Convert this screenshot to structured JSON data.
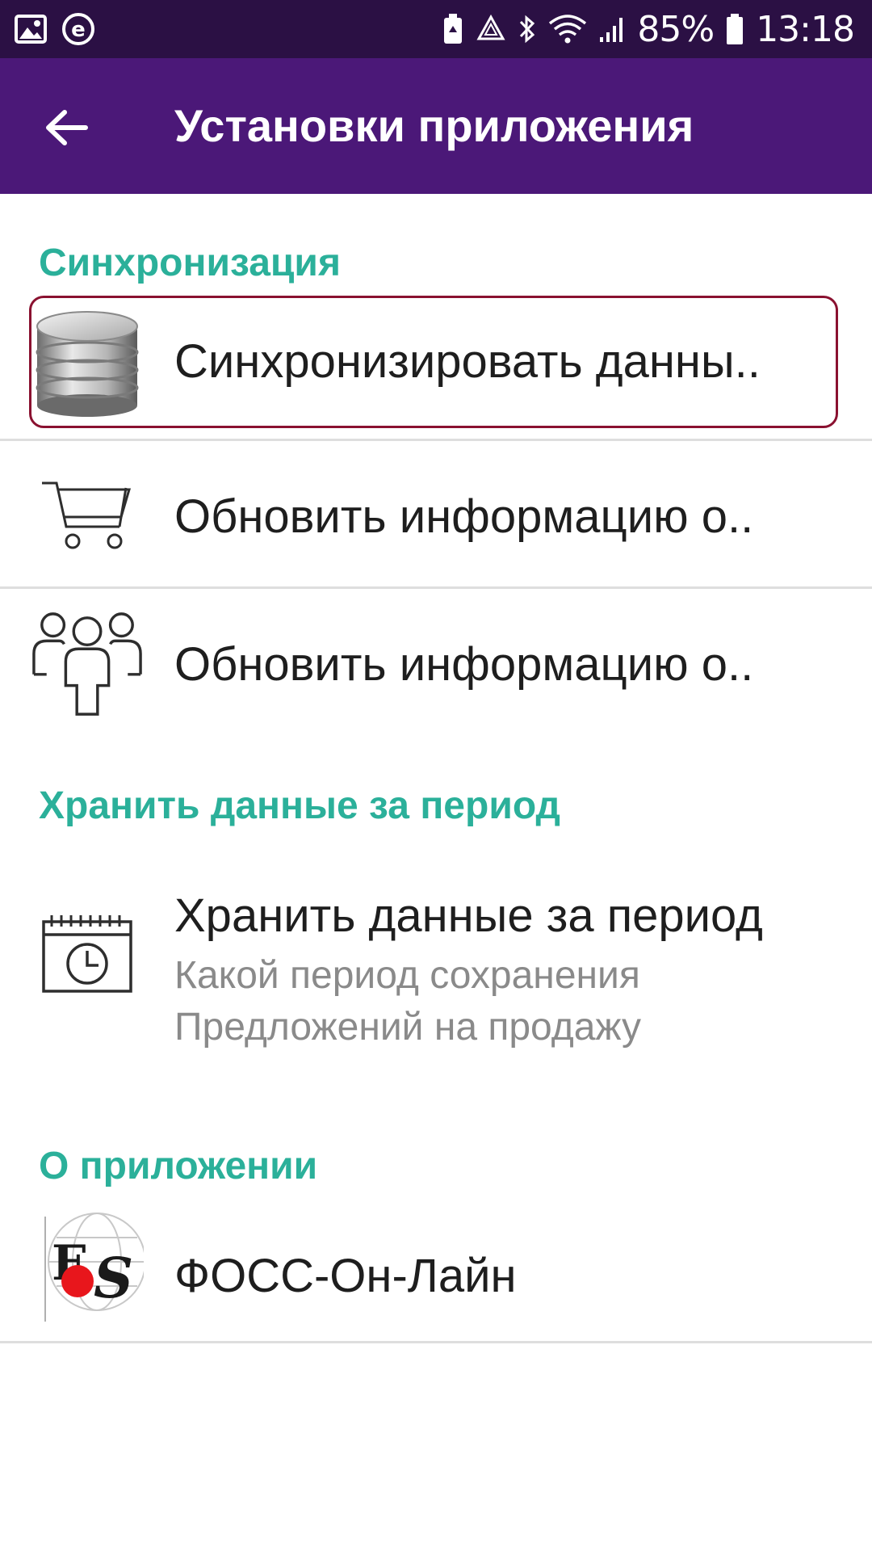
{
  "status_bar": {
    "battery_percent": "85%",
    "time": "13:18",
    "icons": [
      "gallery-icon",
      "e-app-icon",
      "battery-saver-icon",
      "recycle-icon",
      "bluetooth-icon",
      "wifi-icon",
      "signal-icon",
      "battery-icon"
    ]
  },
  "app_bar": {
    "title": "Установки приложения",
    "back_icon": "arrow-back-icon"
  },
  "sections": {
    "sync": {
      "header": "Синхронизация",
      "items": [
        {
          "title": "Синхронизировать данны..",
          "icon": "database-icon"
        },
        {
          "title": "Обновить информацию о..",
          "icon": "cart-icon"
        },
        {
          "title": "Обновить информацию о..",
          "icon": "people-icon"
        }
      ]
    },
    "storage": {
      "header": "Хранить данные за период",
      "item": {
        "title": "Хранить данные за период",
        "summary": "Какой период сохранения Предложений на продажу",
        "icon": "calendar-clock-icon"
      }
    },
    "about": {
      "header": "О приложении",
      "item": {
        "title": "ФОСС-Он-Лайн",
        "icon": "fos-logo-icon"
      }
    }
  },
  "colors": {
    "status_bar": "#2b1044",
    "app_bar": "#4b1878",
    "accent": "#2bb09a",
    "focus_ring": "#8a1130"
  }
}
